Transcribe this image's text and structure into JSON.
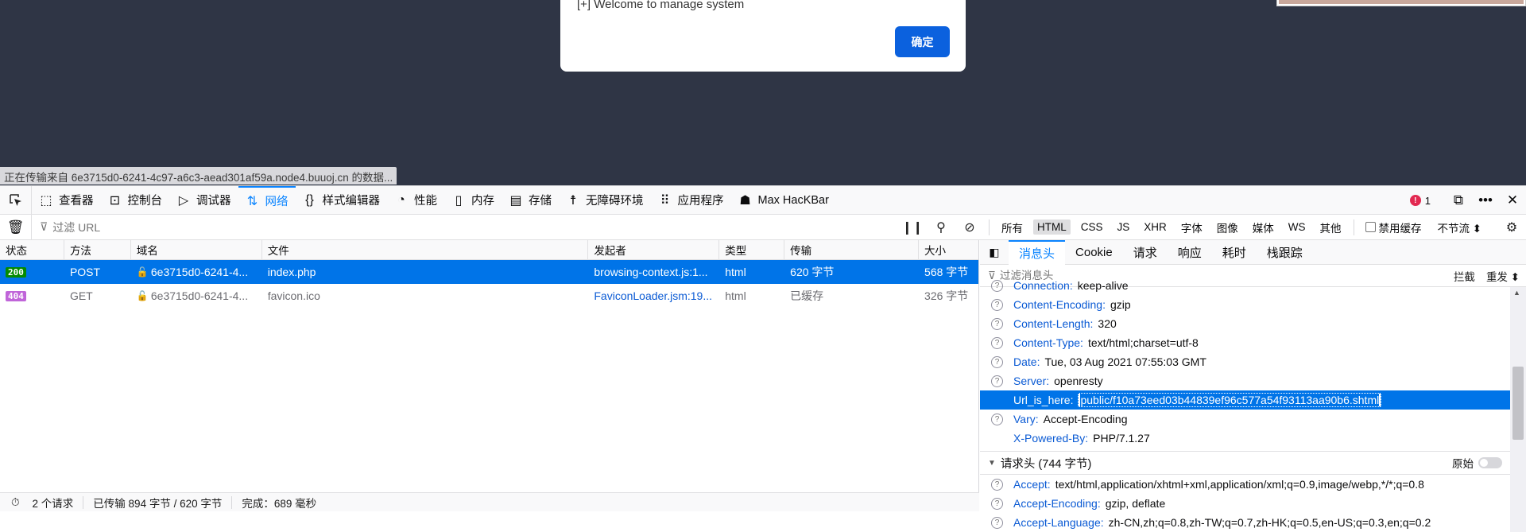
{
  "page": {
    "dialog_message": "[+] Welcome to manage system",
    "dialog_ok": "确定",
    "status_tip": "正在传输来自 6e3715d0-6241-4c97-a6c3-aead301af59a.node4.buuoj.cn 的数据..."
  },
  "devtools": {
    "tabs": [
      {
        "label": "查看器",
        "icon": "inspector-icon"
      },
      {
        "label": "控制台",
        "icon": "console-icon"
      },
      {
        "label": "调试器",
        "icon": "debugger-icon"
      },
      {
        "label": "网络",
        "icon": "network-icon"
      },
      {
        "label": "样式编辑器",
        "icon": "style-editor-icon"
      },
      {
        "label": "性能",
        "icon": "performance-icon"
      },
      {
        "label": "内存",
        "icon": "memory-icon"
      },
      {
        "label": "存储",
        "icon": "storage-icon"
      },
      {
        "label": "无障碍环境",
        "icon": "accessibility-icon"
      },
      {
        "label": "应用程序",
        "icon": "application-icon"
      },
      {
        "label": "Max HacKBar",
        "icon": "hackbar-icon"
      }
    ],
    "error_count": "1",
    "filter_placeholder": "过滤 URL",
    "types": [
      "所有",
      "HTML",
      "CSS",
      "JS",
      "XHR",
      "字体",
      "图像",
      "媒体",
      "WS",
      "其他"
    ],
    "disable_cache": "禁用缓存",
    "throttle": "不节流 ⬍"
  },
  "requests": {
    "columns": [
      "状态",
      "方法",
      "域名",
      "文件",
      "发起者",
      "类型",
      "传输",
      "大小"
    ],
    "rows": [
      {
        "status": "200",
        "method": "POST",
        "domain": "6e3715d0-6241-4...",
        "file": "index.php",
        "initiator": "browsing-context.js:1...",
        "type": "html",
        "transferred": "620 字节",
        "size": "568 字节"
      },
      {
        "status": "404",
        "method": "GET",
        "domain": "6e3715d0-6241-4...",
        "file": "favicon.ico",
        "initiator": "FaviconLoader.jsm:19...",
        "type": "html",
        "transferred": "已缓存",
        "size": "326 字节"
      }
    ],
    "footer": {
      "count": "2 个请求",
      "transferred": "已传输 894 字节 / 620 字节",
      "finish": "完成：689 毫秒"
    }
  },
  "side": {
    "tabs": [
      "消息头",
      "Cookie",
      "请求",
      "响应",
      "耗时",
      "栈跟踪"
    ],
    "filter_placeholder": "过滤消息头",
    "block": "拦截",
    "resend": "重发 ⬍",
    "response_headers": [
      {
        "name": "Connection:",
        "value": "keep-alive"
      },
      {
        "name": "Content-Encoding:",
        "value": "gzip"
      },
      {
        "name": "Content-Length:",
        "value": "320"
      },
      {
        "name": "Content-Type:",
        "value": "text/html;charset=utf-8"
      },
      {
        "name": "Date:",
        "value": "Tue, 03 Aug 2021 07:55:03 GMT"
      },
      {
        "name": "Server:",
        "value": "openresty"
      },
      {
        "name": "Url_is_here:",
        "value": "public/f10a73eed03b44839ef96c577a54f93113aa90b6.shtml"
      },
      {
        "name": "Vary:",
        "value": "Accept-Encoding"
      },
      {
        "name": "X-Powered-By:",
        "value": "PHP/7.1.27"
      }
    ],
    "request_section": "请求头 (744 字节)",
    "raw_label": "原始",
    "request_headers": [
      {
        "name": "Accept:",
        "value": "text/html,application/xhtml+xml,application/xml;q=0.9,image/webp,*/*;q=0.8"
      },
      {
        "name": "Accept-Encoding:",
        "value": "gzip, deflate"
      },
      {
        "name": "Accept-Language:",
        "value": "zh-CN,zh;q=0.8,zh-TW;q=0.7,zh-HK;q=0.5,en-US;q=0.3,en;q=0.2"
      }
    ]
  }
}
